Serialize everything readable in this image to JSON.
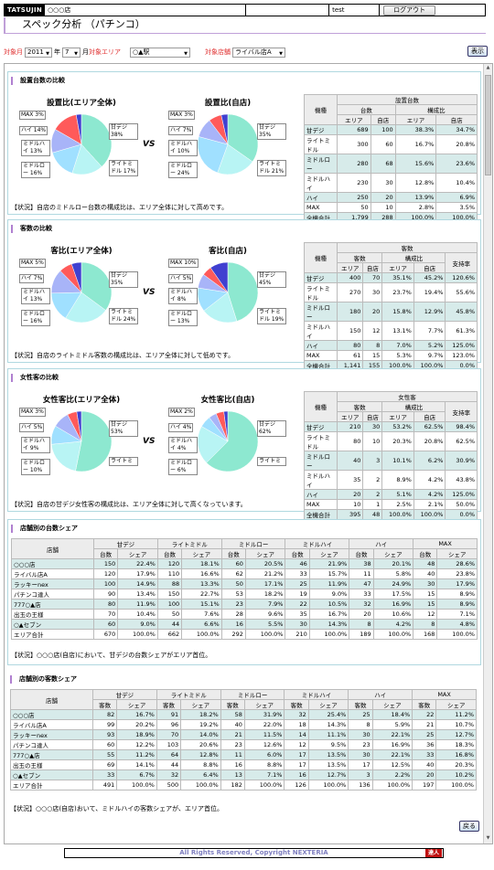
{
  "header": {
    "logo": "TATSUJIN",
    "store": "○○○店",
    "user": "test",
    "logout": "ログアウト"
  },
  "title": "スペック分析 （パチンコ）",
  "filter": {
    "month_label": "対象月",
    "year": "2011",
    "year_unit": "年",
    "month": "7",
    "month_unit": "月",
    "area_label": "対象エリア",
    "area_value": "○▲駅",
    "rival_label": "対象店舗",
    "rival_value": "ライバル店A",
    "show_btn": "表示"
  },
  "colors": {
    "c1": "#8de8d0",
    "c2": "#b8f4f4",
    "c3": "#a0e0ff",
    "c4": "#a8b4f8",
    "c5": "#ff5a5a",
    "c6": "#4040d0"
  },
  "sections": [
    {
      "title": "設置台数の比較",
      "left_title": "設置比(エリア全体)",
      "right_title": "設置比(自店)",
      "left_labels": [
        "MAX 3%",
        "ハイ 14%",
        "ミドルハイ 13%",
        "ミドルロー 16%",
        "甘デジ 38%",
        "ライトミドル 17%"
      ],
      "right_labels": [
        "MAX 3%",
        "ハイ 7%",
        "ミドルハイ 10%",
        "ミドルロー 24%",
        "甘デジ 35%",
        "ライトミドル 21%"
      ],
      "left_values": [
        38.3,
        16.7,
        15.6,
        12.8,
        13.9,
        2.8
      ],
      "right_values": [
        34.7,
        20.8,
        23.6,
        10.4,
        6.9,
        3.5
      ],
      "status": "【状況】自店のミドルロー台数の構成比は、エリア全体に対して高めです。",
      "table": {
        "group": "設置台数",
        "h2": [
          "台数",
          "構成比"
        ],
        "h3": [
          "エリア",
          "自店",
          "エリア",
          "自店"
        ],
        "ratio": false,
        "rows": [
          [
            "甘デジ",
            "689",
            "100",
            "38.3%",
            "34.7%"
          ],
          [
            "ライトミドル",
            "300",
            "60",
            "16.7%",
            "20.8%"
          ],
          [
            "ミドルロー",
            "280",
            "68",
            "15.6%",
            "23.6%"
          ],
          [
            "ミドルハイ",
            "230",
            "30",
            "12.8%",
            "10.4%"
          ],
          [
            "ハイ",
            "250",
            "20",
            "13.9%",
            "6.9%"
          ],
          [
            "MAX",
            "50",
            "10",
            "2.8%",
            "3.5%"
          ],
          [
            "全機合計",
            "1,799",
            "288",
            "100.0%",
            "100.0%"
          ]
        ]
      }
    },
    {
      "title": "客数の比較",
      "left_title": "客比(エリア全体)",
      "right_title": "客比(自店)",
      "left_labels": [
        "MAX 5%",
        "ハイ 7%",
        "ミドルハイ 13%",
        "ミドルロー 16%",
        "甘デジ 35%",
        "ライトミドル 24%"
      ],
      "right_labels": [
        "MAX 10%",
        "ハイ 5%",
        "ミドルハイ 8%",
        "ミドルロー 13%",
        "甘デジ 45%",
        "ライトミドル 19%"
      ],
      "left_values": [
        35.1,
        23.7,
        15.8,
        13.1,
        7.0,
        5.3
      ],
      "right_values": [
        45.2,
        19.4,
        12.9,
        7.7,
        5.2,
        9.7
      ],
      "status": "【状況】自店のライトミドル客数の構成比は、エリア全体に対して低めです。",
      "table": {
        "group": "客数",
        "h2": [
          "客数",
          "構成比",
          "支持率"
        ],
        "h3": [
          "エリア",
          "自店",
          "エリア",
          "自店"
        ],
        "ratio": true,
        "rows": [
          [
            "甘デジ",
            "400",
            "70",
            "35.1%",
            "45.2%",
            "120.6%"
          ],
          [
            "ライトミドル",
            "270",
            "30",
            "23.7%",
            "19.4%",
            "55.6%"
          ],
          [
            "ミドルロー",
            "180",
            "20",
            "15.8%",
            "12.9%",
            "45.8%"
          ],
          [
            "ミドルハイ",
            "150",
            "12",
            "13.1%",
            "7.7%",
            "61.3%"
          ],
          [
            "ハイ",
            "80",
            "8",
            "7.0%",
            "5.2%",
            "125.0%"
          ],
          [
            "MAX",
            "61",
            "15",
            "5.3%",
            "9.7%",
            "123.0%"
          ],
          [
            "全機合計",
            "1,141",
            "155",
            "100.0%",
            "100.0%",
            "0.0%"
          ]
        ]
      }
    },
    {
      "title": "女性客の比較",
      "left_title": "女性客比(エリア全体)",
      "right_title": "女性客比(自店)",
      "left_labels": [
        "MAX 3%",
        "ハイ 5%",
        "ミドルハイ 9%",
        "ミドルロー 10%",
        "甘デジ 53%",
        "ライトミ"
      ],
      "right_labels": [
        "MAX 2%",
        "ハイ 4%",
        "ミドルハイ 4%",
        "ミドルロー 6%",
        "甘デジ 62%",
        "ライトミ"
      ],
      "left_values": [
        53.2,
        20.3,
        10.1,
        8.9,
        5.1,
        2.5
      ],
      "right_values": [
        62.5,
        20.8,
        6.2,
        4.2,
        4.2,
        2.1
      ],
      "status": "【状況】自店の甘デジ女性客の構成比は、エリア全体に対して高くなっています。",
      "table": {
        "group": "女性客",
        "h2": [
          "客数",
          "構成比",
          "支持率"
        ],
        "h3": [
          "エリア",
          "自店",
          "エリア",
          "自店"
        ],
        "ratio": true,
        "rows": [
          [
            "甘デジ",
            "210",
            "30",
            "53.2%",
            "62.5%",
            "98.4%"
          ],
          [
            "ライトミドル",
            "80",
            "10",
            "20.3%",
            "20.8%",
            "62.5%"
          ],
          [
            "ミドルロー",
            "40",
            "3",
            "10.1%",
            "6.2%",
            "30.9%"
          ],
          [
            "ミドルハイ",
            "35",
            "2",
            "8.9%",
            "4.2%",
            "43.8%"
          ],
          [
            "ハイ",
            "20",
            "2",
            "5.1%",
            "4.2%",
            "125.0%"
          ],
          [
            "MAX",
            "10",
            "1",
            "2.5%",
            "2.1%",
            "50.0%"
          ],
          [
            "全機合計",
            "395",
            "48",
            "100.0%",
            "100.0%",
            "0.0%"
          ]
        ]
      }
    }
  ],
  "share_tables": [
    {
      "title": "店舗別の台数シェア",
      "store_col": "店舗",
      "groups": [
        "甘デジ",
        "ライトミドル",
        "ミドルロー",
        "ミドルハイ",
        "ハイ",
        "MAX"
      ],
      "sub": [
        "台数",
        "シェア"
      ],
      "rows": [
        [
          "○○○店",
          "150",
          "22.4%",
          "120",
          "18.1%",
          "60",
          "20.5%",
          "46",
          "21.9%",
          "38",
          "20.1%",
          "48",
          "28.6%"
        ],
        [
          "ライバル店A",
          "120",
          "17.9%",
          "110",
          "16.6%",
          "62",
          "21.2%",
          "33",
          "15.7%",
          "11",
          "5.8%",
          "40",
          "23.8%"
        ],
        [
          "ラッキーnex",
          "100",
          "14.9%",
          "88",
          "13.3%",
          "50",
          "17.1%",
          "25",
          "11.9%",
          "47",
          "24.9%",
          "30",
          "17.9%"
        ],
        [
          "パチンコ達人",
          "90",
          "13.4%",
          "150",
          "22.7%",
          "53",
          "18.2%",
          "19",
          "9.0%",
          "33",
          "17.5%",
          "15",
          "8.9%"
        ],
        [
          "777○▲店",
          "80",
          "11.9%",
          "100",
          "15.1%",
          "23",
          "7.9%",
          "22",
          "10.5%",
          "32",
          "16.9%",
          "15",
          "8.9%"
        ],
        [
          "出玉の王様",
          "70",
          "10.4%",
          "50",
          "7.6%",
          "28",
          "9.6%",
          "35",
          "16.7%",
          "20",
          "10.6%",
          "12",
          "7.1%"
        ],
        [
          "○▲セブン",
          "60",
          "9.0%",
          "44",
          "6.6%",
          "16",
          "5.5%",
          "30",
          "14.3%",
          "8",
          "4.2%",
          "8",
          "4.8%"
        ],
        [
          "エリア合計",
          "670",
          "100.0%",
          "662",
          "100.0%",
          "292",
          "100.0%",
          "210",
          "100.0%",
          "189",
          "100.0%",
          "168",
          "100.0%"
        ]
      ],
      "status": "【状況】○○○店(自店)において、甘デジの台数シェアがエリア首位。"
    },
    {
      "title": "店舗別の客数シェア",
      "store_col": "店舗",
      "groups": [
        "甘デジ",
        "ライトミドル",
        "ミドルロー",
        "ミドルハイ",
        "ハイ",
        "MAX"
      ],
      "sub": [
        "客数",
        "シェア"
      ],
      "rows": [
        [
          "○○○店",
          "82",
          "16.7%",
          "91",
          "18.2%",
          "58",
          "31.9%",
          "32",
          "25.4%",
          "25",
          "18.4%",
          "22",
          "11.2%"
        ],
        [
          "ライバル店A",
          "99",
          "20.2%",
          "96",
          "19.2%",
          "40",
          "22.0%",
          "18",
          "14.3%",
          "8",
          "5.9%",
          "21",
          "10.7%"
        ],
        [
          "ラッキーnex",
          "93",
          "18.9%",
          "70",
          "14.0%",
          "21",
          "11.5%",
          "14",
          "11.1%",
          "30",
          "22.1%",
          "25",
          "12.7%"
        ],
        [
          "パチンコ達人",
          "60",
          "12.2%",
          "103",
          "20.6%",
          "23",
          "12.6%",
          "12",
          "9.5%",
          "23",
          "16.9%",
          "36",
          "18.3%"
        ],
        [
          "777○▲店",
          "55",
          "11.2%",
          "64",
          "12.8%",
          "11",
          "6.0%",
          "17",
          "13.5%",
          "30",
          "22.1%",
          "33",
          "16.8%"
        ],
        [
          "出玉の王様",
          "69",
          "14.1%",
          "44",
          "8.8%",
          "16",
          "8.8%",
          "17",
          "13.5%",
          "17",
          "12.5%",
          "40",
          "20.3%"
        ],
        [
          "○▲セブン",
          "33",
          "6.7%",
          "32",
          "6.4%",
          "13",
          "7.1%",
          "16",
          "12.7%",
          "3",
          "2.2%",
          "20",
          "10.2%"
        ],
        [
          "エリア合計",
          "491",
          "100.0%",
          "500",
          "100.0%",
          "182",
          "100.0%",
          "126",
          "100.0%",
          "136",
          "100.0%",
          "197",
          "100.0%"
        ]
      ],
      "status": "【状況】○○○店(自店)おいて、ミドルハイの客数シェアが、エリア首位。"
    }
  ],
  "back_btn": "戻る",
  "footer": "All Rights Reserved, Copyright NEXTERIA",
  "footer_btn": "達人"
}
